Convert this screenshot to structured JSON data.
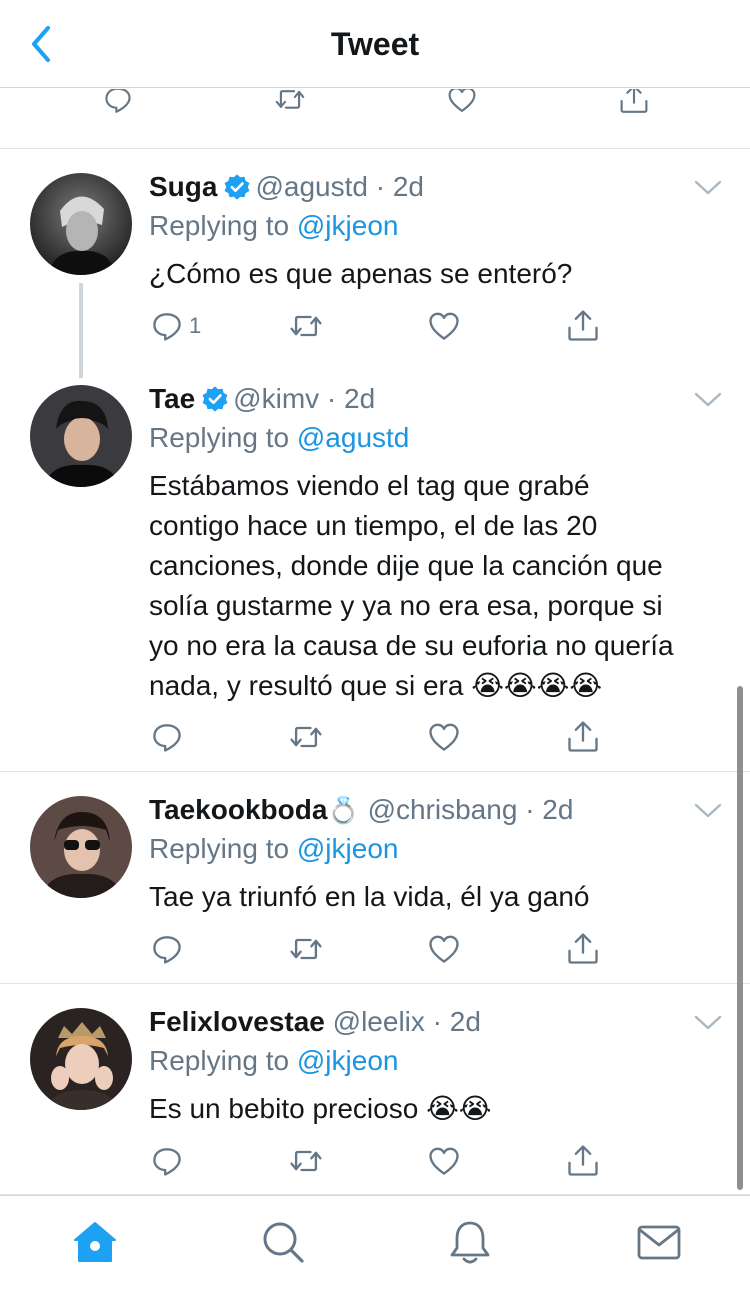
{
  "header": {
    "title": "Tweet",
    "back_icon": "chevron-left-icon"
  },
  "colors": {
    "accent": "#1da1f2",
    "mention": "#1b95e0",
    "secondary_text": "#657786",
    "icon": "#657786",
    "divider": "#dfe4e8"
  },
  "tweets": [
    {
      "name": "Suga",
      "verified": true,
      "handle": "@agustd",
      "time": "· 2d",
      "replying_prefix": "Replying to ",
      "replying_to": "@jkjeon",
      "text": "¿Cómo es que apenas se enteró?",
      "reply_count": "1"
    },
    {
      "name": "Tae",
      "verified": true,
      "handle": "@kimv",
      "time": "· 2d",
      "replying_prefix": "Replying to ",
      "replying_to": "@agustd",
      "text_lines": [
        "Estábamos viendo el tag que grabé",
        "contigo hace un tiempo, el de las 20",
        "canciones, donde dije que la canción que",
        "solía gustarme y ya no era esa, porque si",
        "yo no era la causa de su euforia no quería",
        "nada, y resultó que si era"
      ],
      "emojis": "😭😭😭😭",
      "reply_count": ""
    },
    {
      "name": "Taekookboda",
      "name_emoji": "💍",
      "verified": false,
      "handle": "@chrisbang",
      "time": "· 2d",
      "replying_prefix": "Replying to ",
      "replying_to": "@jkjeon",
      "text": "Tae ya triunfó en la vida, él ya ganó",
      "reply_count": ""
    },
    {
      "name": "Felixlovestae",
      "verified": false,
      "handle": "@leelix",
      "time": "· 2d",
      "replying_prefix": "Replying to ",
      "replying_to": "@jkjeon",
      "text": "Es un bebito precioso",
      "emojis": "😭😭",
      "reply_count": ""
    }
  ],
  "action_icons": [
    "reply-icon",
    "retweet-icon",
    "like-icon",
    "share-icon"
  ],
  "tabbar": {
    "items": [
      "home-icon",
      "search-icon",
      "notifications-icon",
      "messages-icon"
    ],
    "active": "home-icon"
  }
}
